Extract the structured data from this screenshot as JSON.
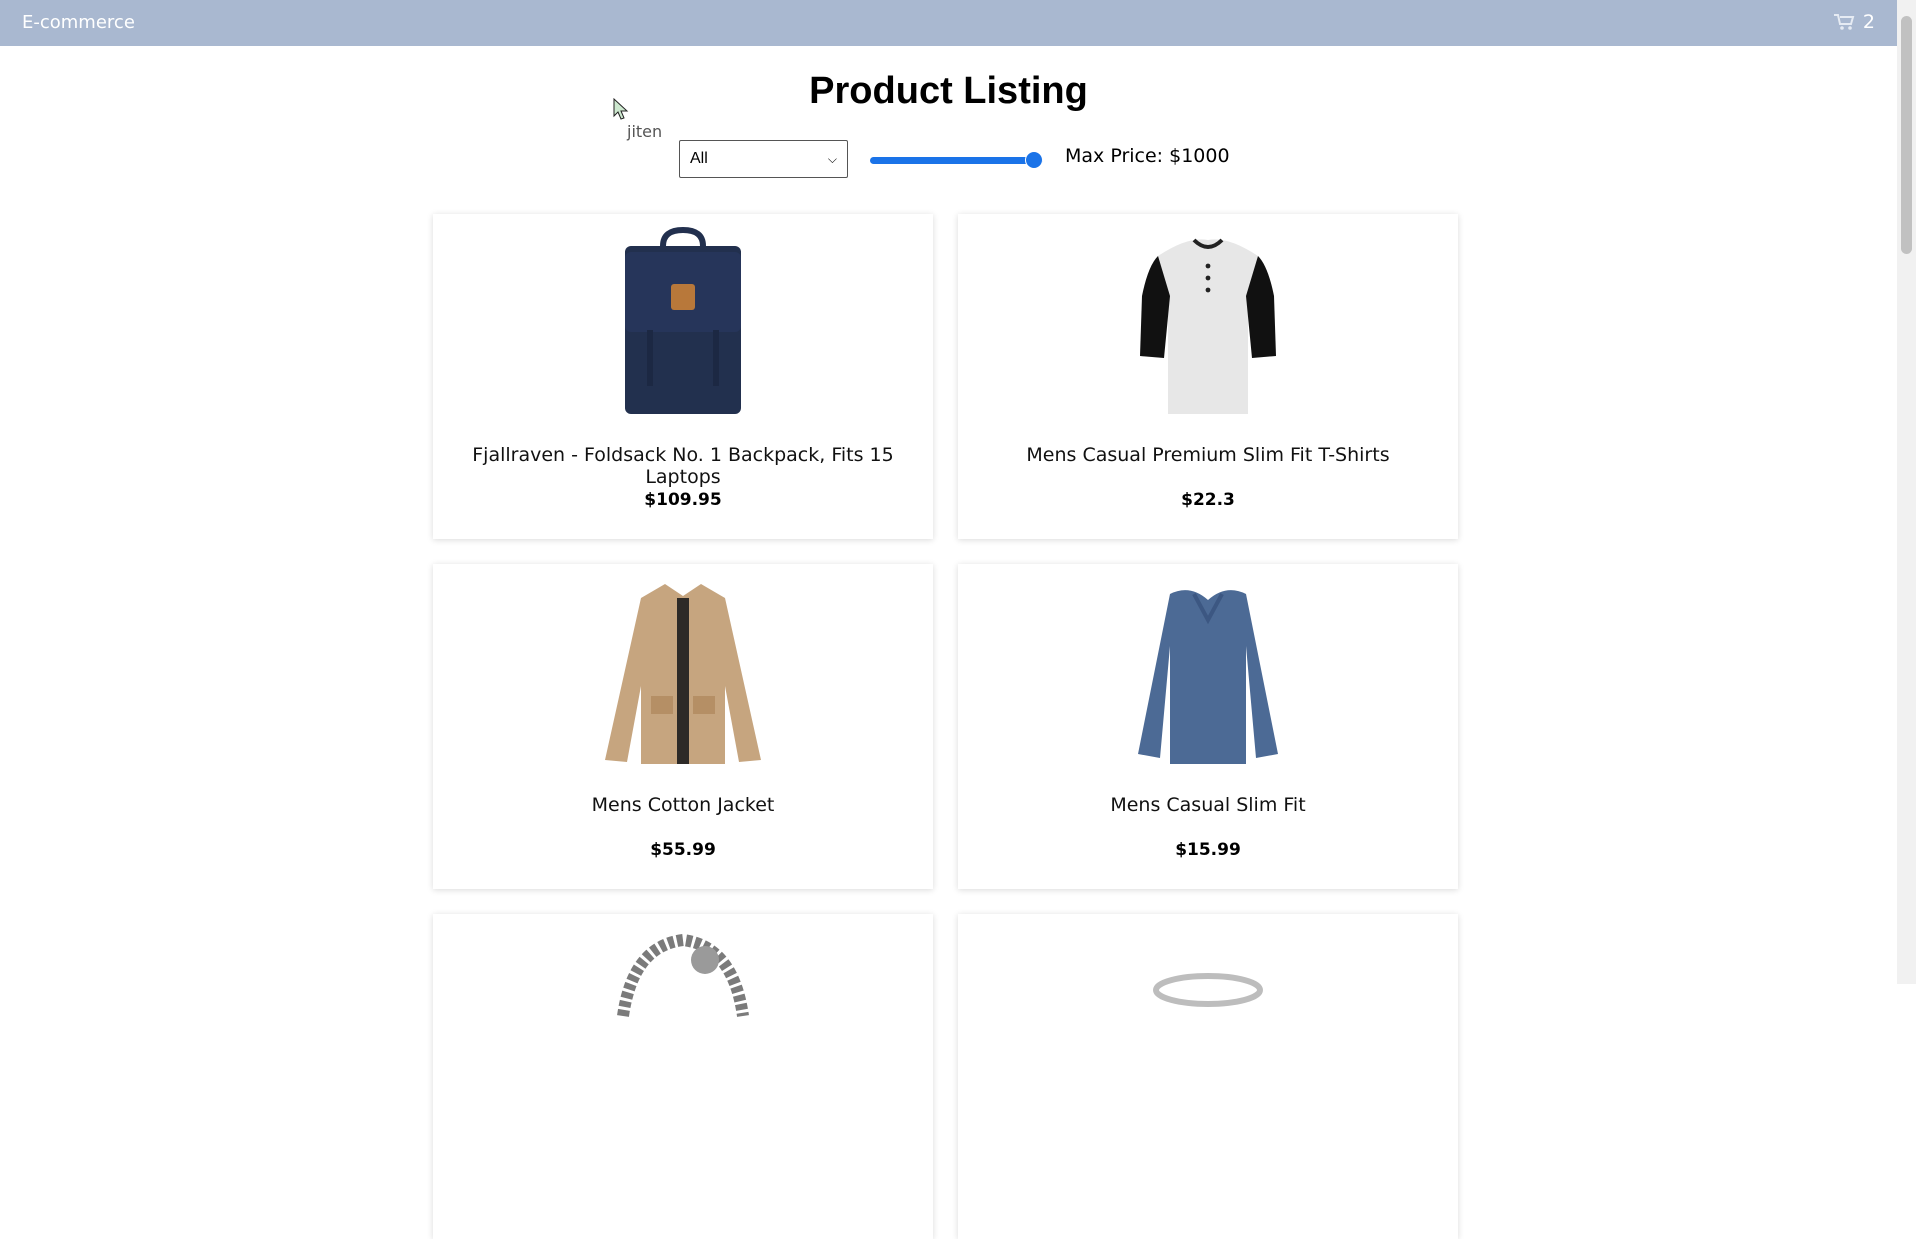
{
  "header": {
    "brand": "E-commerce",
    "cart_count": "2",
    "cart_icon": "cart-icon"
  },
  "page": {
    "title": "Product Listing"
  },
  "filters": {
    "user_label": "jiten",
    "category_selected": "All",
    "max_price_label": "Max Price: $1000",
    "slider_value_fraction": 1.0
  },
  "products": [
    {
      "name": "Fjallraven - Foldsack No. 1 Backpack, Fits 15 Laptops",
      "price": "$109.95",
      "image": "backpack"
    },
    {
      "name": "Mens Casual Premium Slim Fit T-Shirts",
      "price": "$22.3",
      "image": "tshirt"
    },
    {
      "name": "Mens Cotton Jacket",
      "price": "$55.99",
      "image": "jacket"
    },
    {
      "name": "Mens Casual Slim Fit",
      "price": "$15.99",
      "image": "longsleeve"
    },
    {
      "name": "",
      "price": "",
      "image": "bracelet"
    },
    {
      "name": "",
      "price": "",
      "image": "ring"
    }
  ],
  "colors": {
    "header_bg": "#a9b8d0",
    "accent": "#1a73e8"
  }
}
